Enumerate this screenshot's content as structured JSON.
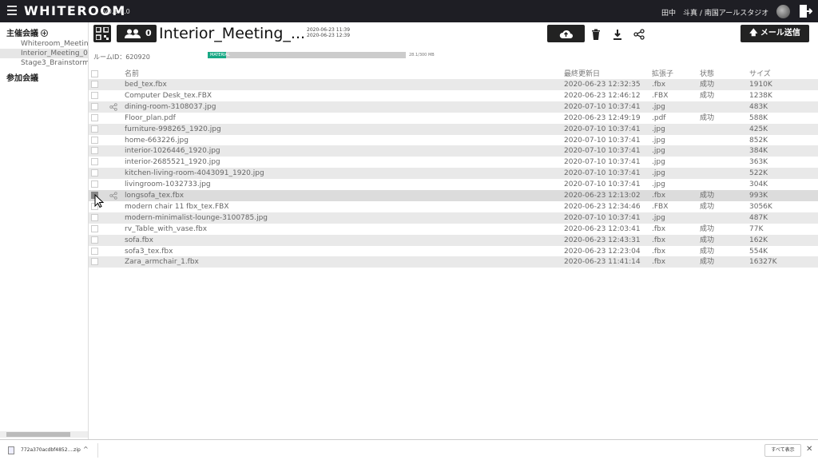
{
  "topbar": {
    "logo": "WHITEROOM",
    "version": "v0.8.8.0",
    "user": "田中　斗真 / 南国アールスタジオ"
  },
  "sidebar": {
    "hosted_label": "主催会議",
    "joined_label": "参加会議",
    "hosted_items": [
      {
        "label": "Whiteroom_Meeting_05"
      },
      {
        "label": "Interior_Meeting_0623"
      },
      {
        "label": "Stage3_Brainstorming"
      }
    ]
  },
  "room": {
    "title": "Interior_Meeting_...",
    "member_count": "0",
    "date_created": "2020-06-23 11:39",
    "date_updated": "2020-06-23 12:39",
    "room_id_label": "ルームID：620920",
    "storage_label": "MATERIAL",
    "storage_text": "28.1/300 MB",
    "storage_fraction": 0.094,
    "mail_button": "メール送信"
  },
  "table": {
    "headers": {
      "name": "名前",
      "date": "最終更新日",
      "ext": "拡張子",
      "status": "状態",
      "size": "サイズ"
    },
    "rows": [
      {
        "name": "bed_tex.fbx",
        "date": "2020-06-23 12:32:35",
        "ext": ".fbx",
        "status": "成功",
        "size": "1910K",
        "share": false,
        "checked": false
      },
      {
        "name": "Computer Desk_tex.FBX",
        "date": "2020-06-23 12:46:12",
        "ext": ".FBX",
        "status": "成功",
        "size": "1238K",
        "share": false,
        "checked": false
      },
      {
        "name": "dining-room-3108037.jpg",
        "date": "2020-07-10 10:37:41",
        "ext": ".jpg",
        "status": "",
        "size": "483K",
        "share": true,
        "checked": false
      },
      {
        "name": "Floor_plan.pdf",
        "date": "2020-06-23 12:49:19",
        "ext": ".pdf",
        "status": "成功",
        "size": "588K",
        "share": false,
        "checked": false
      },
      {
        "name": "furniture-998265_1920.jpg",
        "date": "2020-07-10 10:37:41",
        "ext": ".jpg",
        "status": "",
        "size": "425K",
        "share": false,
        "checked": false
      },
      {
        "name": "home-663226.jpg",
        "date": "2020-07-10 10:37:41",
        "ext": ".jpg",
        "status": "",
        "size": "852K",
        "share": false,
        "checked": false
      },
      {
        "name": "interior-1026446_1920.jpg",
        "date": "2020-07-10 10:37:41",
        "ext": ".jpg",
        "status": "",
        "size": "384K",
        "share": false,
        "checked": false
      },
      {
        "name": "interior-2685521_1920.jpg",
        "date": "2020-07-10 10:37:41",
        "ext": ".jpg",
        "status": "",
        "size": "363K",
        "share": false,
        "checked": false
      },
      {
        "name": "kitchen-living-room-4043091_1920.jpg",
        "date": "2020-07-10 10:37:41",
        "ext": ".jpg",
        "status": "",
        "size": "522K",
        "share": false,
        "checked": false
      },
      {
        "name": "livingroom-1032733.jpg",
        "date": "2020-07-10 10:37:41",
        "ext": ".jpg",
        "status": "",
        "size": "304K",
        "share": false,
        "checked": false
      },
      {
        "name": "longsofa_tex.fbx",
        "date": "2020-06-23 12:13:02",
        "ext": ".fbx",
        "status": "成功",
        "size": "993K",
        "share": true,
        "checked": true
      },
      {
        "name": "modern chair 11 fbx_tex.FBX",
        "date": "2020-06-23 12:34:46",
        "ext": ".FBX",
        "status": "成功",
        "size": "3056K",
        "share": false,
        "checked": false
      },
      {
        "name": "modern-minimalist-lounge-3100785.jpg",
        "date": "2020-07-10 10:37:41",
        "ext": ".jpg",
        "status": "",
        "size": "487K",
        "share": false,
        "checked": false
      },
      {
        "name": "rv_Table_with_vase.fbx",
        "date": "2020-06-23 12:03:41",
        "ext": ".fbx",
        "status": "成功",
        "size": "77K",
        "share": false,
        "checked": false
      },
      {
        "name": "sofa.fbx",
        "date": "2020-06-23 12:43:31",
        "ext": ".fbx",
        "status": "成功",
        "size": "162K",
        "share": false,
        "checked": false
      },
      {
        "name": "sofa3_tex.fbx",
        "date": "2020-06-23 12:23:04",
        "ext": ".fbx",
        "status": "成功",
        "size": "554K",
        "share": false,
        "checked": false
      },
      {
        "name": "Zara_armchair_1.fbx",
        "date": "2020-06-23 11:41:14",
        "ext": ".fbx",
        "status": "成功",
        "size": "16327K",
        "share": false,
        "checked": false
      }
    ]
  },
  "downloads": {
    "file": "772a370acdbf4852....zip",
    "show_all": "すべて表示"
  },
  "colors": {
    "topbar": "#1e1e24",
    "accent": "#18a884",
    "button": "#222222"
  }
}
